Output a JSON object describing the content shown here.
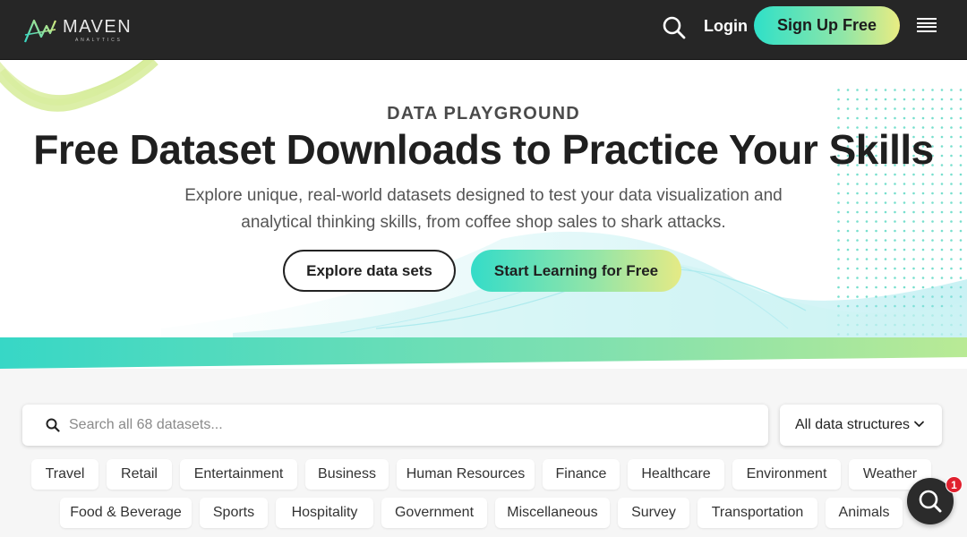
{
  "header": {
    "logo_name": "MAVEN",
    "logo_sub": "ANALYTICS",
    "login_label": "Login",
    "signup_label": "Sign Up Free",
    "icons": [
      "search-icon",
      "menu-icon"
    ]
  },
  "hero": {
    "eyebrow": "DATA PLAYGROUND",
    "headline": "Free Dataset Downloads to Practice Your Skills",
    "subhead": "Explore unique, real-world datasets designed to test your data visualization and analytical thinking skills, from coffee shop sales to shark attacks.",
    "explore_label": "Explore data sets",
    "learn_label": "Start Learning for Free"
  },
  "search": {
    "placeholder": "Search all 68 datasets...",
    "value": ""
  },
  "structure_select": {
    "selected": "All data structures"
  },
  "categories_row1": [
    "Travel",
    "Retail",
    "Entertainment",
    "Business",
    "Human Resources",
    "Finance",
    "Healthcare",
    "Environment",
    "Weather"
  ],
  "categories_row2": [
    "Food & Beverage",
    "Sports",
    "Hospitality",
    "Government",
    "Miscellaneous",
    "Survey",
    "Transportation",
    "Animals"
  ],
  "chat": {
    "badge_count": "1"
  },
  "colors": {
    "accent_teal": "#2fe0c8",
    "accent_lime": "#e9ec82",
    "header_bg": "#262626",
    "badge_red": "#e0202e"
  }
}
